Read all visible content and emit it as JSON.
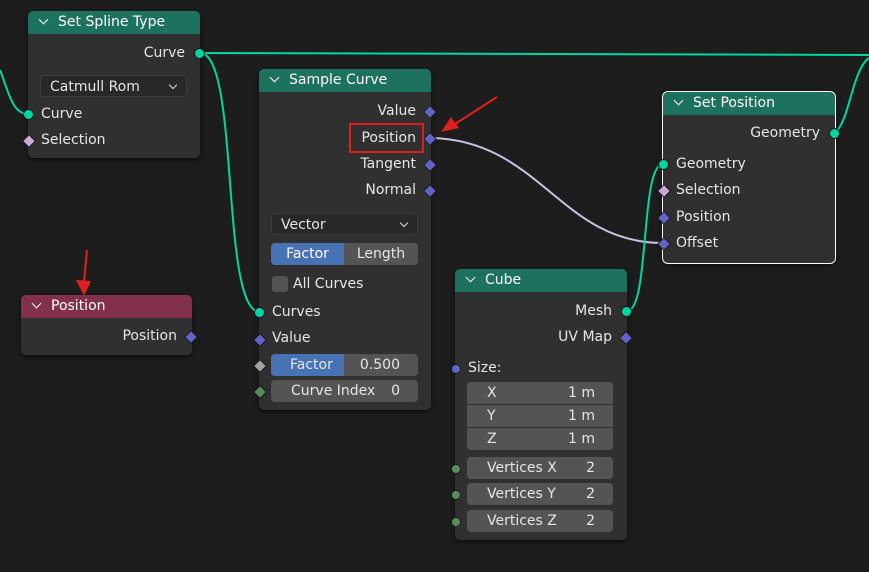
{
  "set_spline_type": {
    "title": "Set Spline Type",
    "output_curve": "Curve",
    "spline_type": "Catmull Rom",
    "input_curve": "Curve",
    "input_selection": "Selection"
  },
  "position_node": {
    "title": "Position",
    "output_position": "Position"
  },
  "sample_curve": {
    "title": "Sample Curve",
    "outputs": [
      "Value",
      "Position",
      "Tangent",
      "Normal"
    ],
    "data_type": "Vector",
    "mode_factor": "Factor",
    "mode_length": "Length",
    "all_curves": "All Curves",
    "input_curves": "Curves",
    "input_value": "Value",
    "factor_label": "Factor",
    "factor_value": "0.500",
    "curve_index_label": "Curve Index",
    "curve_index_value": "0"
  },
  "cube": {
    "title": "Cube",
    "output_mesh": "Mesh",
    "output_uvmap": "UV Map",
    "size_label": "Size:",
    "size_x_label": "X",
    "size_x_value": "1 m",
    "size_y_label": "Y",
    "size_y_value": "1 m",
    "size_z_label": "Z",
    "size_z_value": "1 m",
    "vertices_x_label": "Vertices X",
    "vertices_x_value": "2",
    "vertices_y_label": "Vertices Y",
    "vertices_y_value": "2",
    "vertices_z_label": "Vertices Z",
    "vertices_z_value": "2"
  },
  "set_position": {
    "title": "Set Position",
    "output_geometry": "Geometry",
    "input_geometry": "Geometry",
    "input_selection": "Selection",
    "input_position": "Position",
    "input_offset": "Offset"
  },
  "colors": {
    "geometry_socket": "#00d6a3",
    "vector_socket": "#6363c7",
    "header_geometry": "#1d725e",
    "header_input": "#83314a",
    "annotation_red": "#e0201e",
    "active_button": "#4772b3"
  }
}
